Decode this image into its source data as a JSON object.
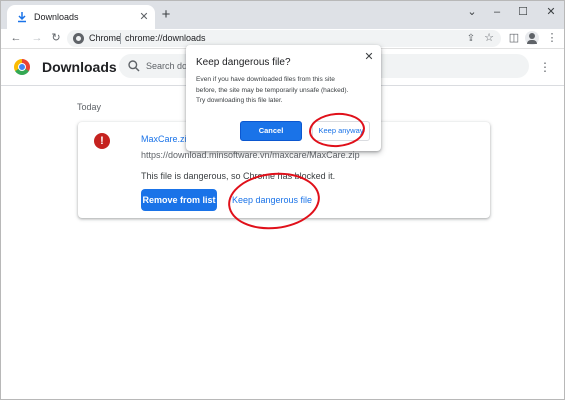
{
  "browser": {
    "tab_title": "Downloads",
    "new_tab_symbol": "+",
    "omnibox_label": "Chrome",
    "url": "chrome://downloads"
  },
  "icons": {
    "tab_favicon": "download-icon",
    "back": "arrow-left-icon",
    "forward": "arrow-right-icon",
    "reload": "reload-icon",
    "site_info": "chrome-icon",
    "share": "share-icon",
    "bookmark": "star-icon",
    "side_panel": "side-panel-icon",
    "profile": "avatar-icon",
    "menu": "kebab-menu-icon",
    "search": "search-icon",
    "warning": "warning-icon"
  },
  "page": {
    "title": "Downloads",
    "search_placeholder": "Search dow"
  },
  "downloads": {
    "section_label": "Today",
    "items": [
      {
        "file_name": "MaxCare.zip",
        "url": "https://download.minsoftware.vn/maxcare/MaxCare.zip",
        "status": "This file is dangerous, so Chrome has blocked it.",
        "remove_label": "Remove from list",
        "keep_label": "Keep dangerous file"
      }
    ]
  },
  "dialog": {
    "title": "Keep dangerous file?",
    "body_lines": [
      "Even if you have downloaded files from this site",
      "before, the site may be temporarily unsafe (hacked).",
      "Try downloading this file later."
    ],
    "cancel_label": "Cancel",
    "keep_label": "Keep anyway"
  },
  "colors": {
    "accent": "#1a73e8",
    "danger": "#c5221f",
    "annotation": "#e0101a",
    "tabstrip": "#dee1e6"
  }
}
